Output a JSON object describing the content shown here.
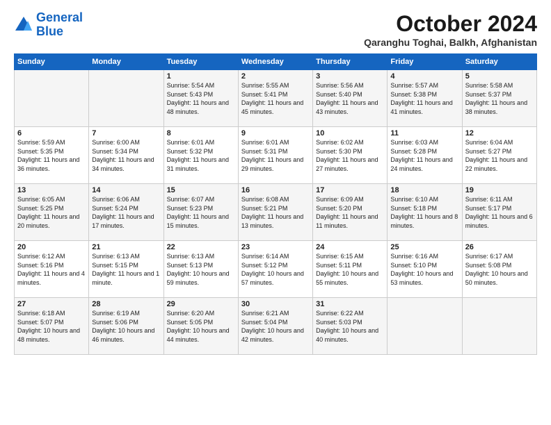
{
  "header": {
    "logo_line1": "General",
    "logo_line2": "Blue",
    "month": "October 2024",
    "location": "Qaranghu Toghai, Balkh, Afghanistan"
  },
  "days_of_week": [
    "Sunday",
    "Monday",
    "Tuesday",
    "Wednesday",
    "Thursday",
    "Friday",
    "Saturday"
  ],
  "weeks": [
    [
      {
        "day": "",
        "detail": ""
      },
      {
        "day": "",
        "detail": ""
      },
      {
        "day": "1",
        "detail": "Sunrise: 5:54 AM\nSunset: 5:43 PM\nDaylight: 11 hours and 48 minutes."
      },
      {
        "day": "2",
        "detail": "Sunrise: 5:55 AM\nSunset: 5:41 PM\nDaylight: 11 hours and 45 minutes."
      },
      {
        "day": "3",
        "detail": "Sunrise: 5:56 AM\nSunset: 5:40 PM\nDaylight: 11 hours and 43 minutes."
      },
      {
        "day": "4",
        "detail": "Sunrise: 5:57 AM\nSunset: 5:38 PM\nDaylight: 11 hours and 41 minutes."
      },
      {
        "day": "5",
        "detail": "Sunrise: 5:58 AM\nSunset: 5:37 PM\nDaylight: 11 hours and 38 minutes."
      }
    ],
    [
      {
        "day": "6",
        "detail": "Sunrise: 5:59 AM\nSunset: 5:35 PM\nDaylight: 11 hours and 36 minutes."
      },
      {
        "day": "7",
        "detail": "Sunrise: 6:00 AM\nSunset: 5:34 PM\nDaylight: 11 hours and 34 minutes."
      },
      {
        "day": "8",
        "detail": "Sunrise: 6:01 AM\nSunset: 5:32 PM\nDaylight: 11 hours and 31 minutes."
      },
      {
        "day": "9",
        "detail": "Sunrise: 6:01 AM\nSunset: 5:31 PM\nDaylight: 11 hours and 29 minutes."
      },
      {
        "day": "10",
        "detail": "Sunrise: 6:02 AM\nSunset: 5:30 PM\nDaylight: 11 hours and 27 minutes."
      },
      {
        "day": "11",
        "detail": "Sunrise: 6:03 AM\nSunset: 5:28 PM\nDaylight: 11 hours and 24 minutes."
      },
      {
        "day": "12",
        "detail": "Sunrise: 6:04 AM\nSunset: 5:27 PM\nDaylight: 11 hours and 22 minutes."
      }
    ],
    [
      {
        "day": "13",
        "detail": "Sunrise: 6:05 AM\nSunset: 5:25 PM\nDaylight: 11 hours and 20 minutes."
      },
      {
        "day": "14",
        "detail": "Sunrise: 6:06 AM\nSunset: 5:24 PM\nDaylight: 11 hours and 17 minutes."
      },
      {
        "day": "15",
        "detail": "Sunrise: 6:07 AM\nSunset: 5:23 PM\nDaylight: 11 hours and 15 minutes."
      },
      {
        "day": "16",
        "detail": "Sunrise: 6:08 AM\nSunset: 5:21 PM\nDaylight: 11 hours and 13 minutes."
      },
      {
        "day": "17",
        "detail": "Sunrise: 6:09 AM\nSunset: 5:20 PM\nDaylight: 11 hours and 11 minutes."
      },
      {
        "day": "18",
        "detail": "Sunrise: 6:10 AM\nSunset: 5:18 PM\nDaylight: 11 hours and 8 minutes."
      },
      {
        "day": "19",
        "detail": "Sunrise: 6:11 AM\nSunset: 5:17 PM\nDaylight: 11 hours and 6 minutes."
      }
    ],
    [
      {
        "day": "20",
        "detail": "Sunrise: 6:12 AM\nSunset: 5:16 PM\nDaylight: 11 hours and 4 minutes."
      },
      {
        "day": "21",
        "detail": "Sunrise: 6:13 AM\nSunset: 5:15 PM\nDaylight: 11 hours and 1 minute."
      },
      {
        "day": "22",
        "detail": "Sunrise: 6:13 AM\nSunset: 5:13 PM\nDaylight: 10 hours and 59 minutes."
      },
      {
        "day": "23",
        "detail": "Sunrise: 6:14 AM\nSunset: 5:12 PM\nDaylight: 10 hours and 57 minutes."
      },
      {
        "day": "24",
        "detail": "Sunrise: 6:15 AM\nSunset: 5:11 PM\nDaylight: 10 hours and 55 minutes."
      },
      {
        "day": "25",
        "detail": "Sunrise: 6:16 AM\nSunset: 5:10 PM\nDaylight: 10 hours and 53 minutes."
      },
      {
        "day": "26",
        "detail": "Sunrise: 6:17 AM\nSunset: 5:08 PM\nDaylight: 10 hours and 50 minutes."
      }
    ],
    [
      {
        "day": "27",
        "detail": "Sunrise: 6:18 AM\nSunset: 5:07 PM\nDaylight: 10 hours and 48 minutes."
      },
      {
        "day": "28",
        "detail": "Sunrise: 6:19 AM\nSunset: 5:06 PM\nDaylight: 10 hours and 46 minutes."
      },
      {
        "day": "29",
        "detail": "Sunrise: 6:20 AM\nSunset: 5:05 PM\nDaylight: 10 hours and 44 minutes."
      },
      {
        "day": "30",
        "detail": "Sunrise: 6:21 AM\nSunset: 5:04 PM\nDaylight: 10 hours and 42 minutes."
      },
      {
        "day": "31",
        "detail": "Sunrise: 6:22 AM\nSunset: 5:03 PM\nDaylight: 10 hours and 40 minutes."
      },
      {
        "day": "",
        "detail": ""
      },
      {
        "day": "",
        "detail": ""
      }
    ]
  ]
}
